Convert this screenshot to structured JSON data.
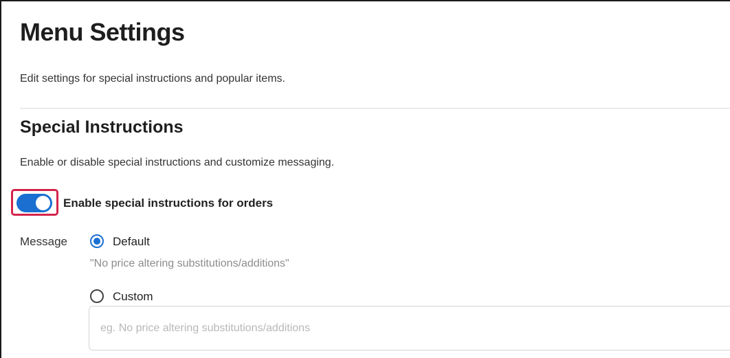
{
  "page": {
    "title": "Menu Settings",
    "description": "Edit settings for special instructions and popular items."
  },
  "special_instructions": {
    "title": "Special Instructions",
    "description": "Enable or disable special instructions and customize messaging.",
    "toggle": {
      "label": "Enable special instructions for orders",
      "enabled": true
    },
    "message": {
      "label": "Message",
      "selected": "Default",
      "options": {
        "default_label": "Default",
        "default_text": "\"No price altering substitutions/additions\"",
        "custom_label": "Custom",
        "custom_value": "",
        "custom_placeholder": "eg. No price altering substitutions/additions"
      }
    }
  },
  "colors": {
    "accent": "#1a6fd1",
    "highlight": "#d4234a"
  }
}
